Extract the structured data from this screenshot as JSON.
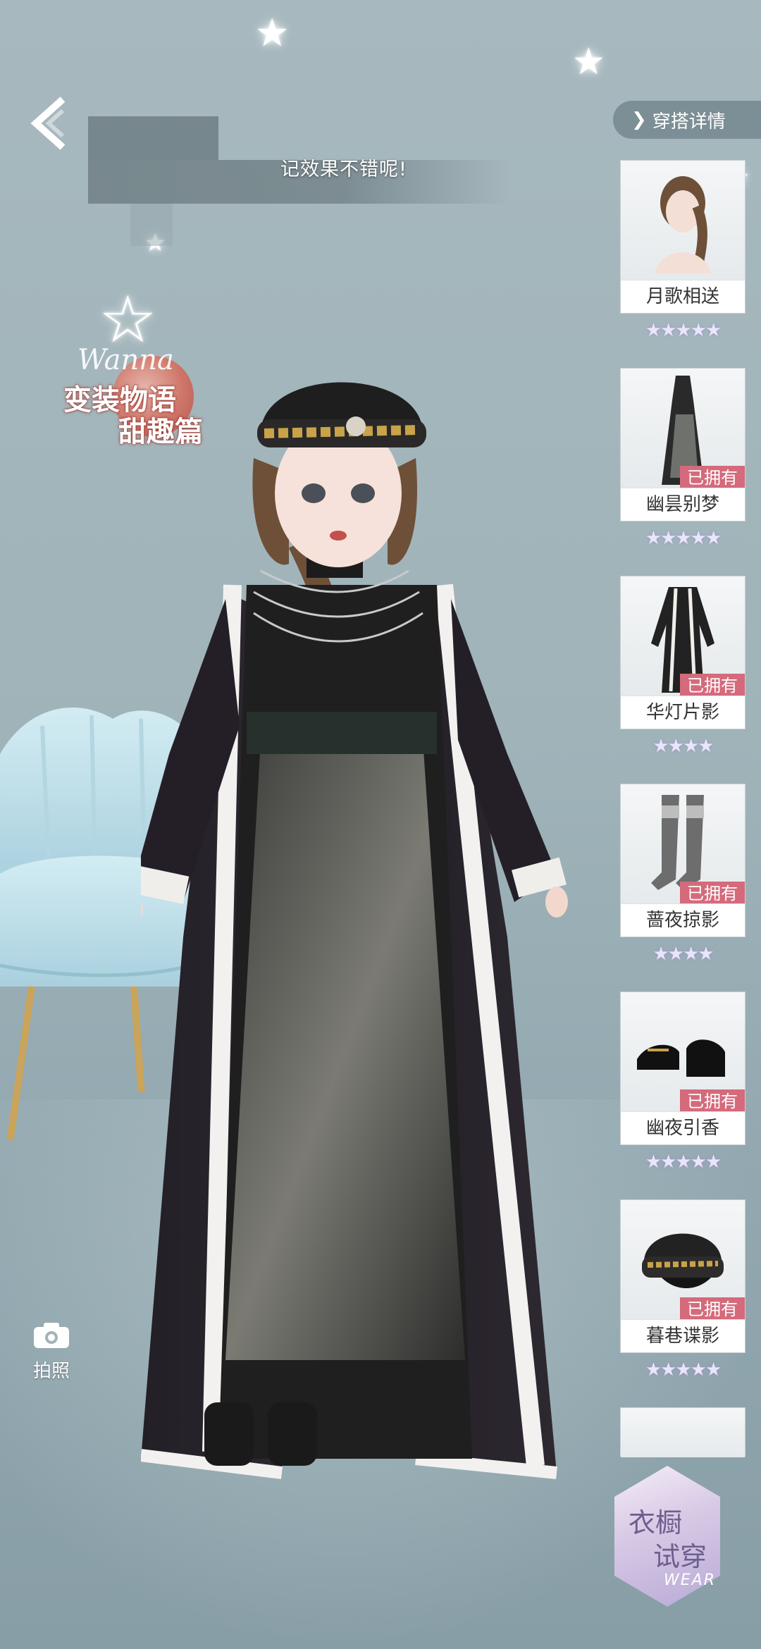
{
  "dialog": {
    "visible_text": "记效果不错呢!"
  },
  "event_badge": {
    "script": "Wanna",
    "line1": "变装物语",
    "line2": "甜趣篇"
  },
  "camera": {
    "label": "拍照",
    "icon": "camera-icon"
  },
  "outfit_details": {
    "label": "穿搭详情",
    "icon": "chevron-right-icon"
  },
  "items": [
    {
      "name": "月歌相送",
      "owned": "",
      "stars": 5,
      "thumb": "hair"
    },
    {
      "name": "幽昙别梦",
      "owned": "已拥有",
      "stars": 5,
      "thumb": "dress"
    },
    {
      "name": "华灯片影",
      "owned": "已拥有",
      "stars": 4,
      "thumb": "coat"
    },
    {
      "name": "蔷夜掠影",
      "owned": "已拥有",
      "stars": 4,
      "thumb": "stockings"
    },
    {
      "name": "幽夜引香",
      "owned": "已拥有",
      "stars": 5,
      "thumb": "shoes"
    },
    {
      "name": "暮巷谍影",
      "owned": "已拥有",
      "stars": 5,
      "thumb": "hat"
    }
  ],
  "wardrobe": {
    "line1": "衣橱",
    "line2": "试穿",
    "en": "WEAR"
  },
  "colors": {
    "owned_badge": "#d46a7b",
    "star": "#e9e6f6",
    "background": "#a7b9bf"
  }
}
